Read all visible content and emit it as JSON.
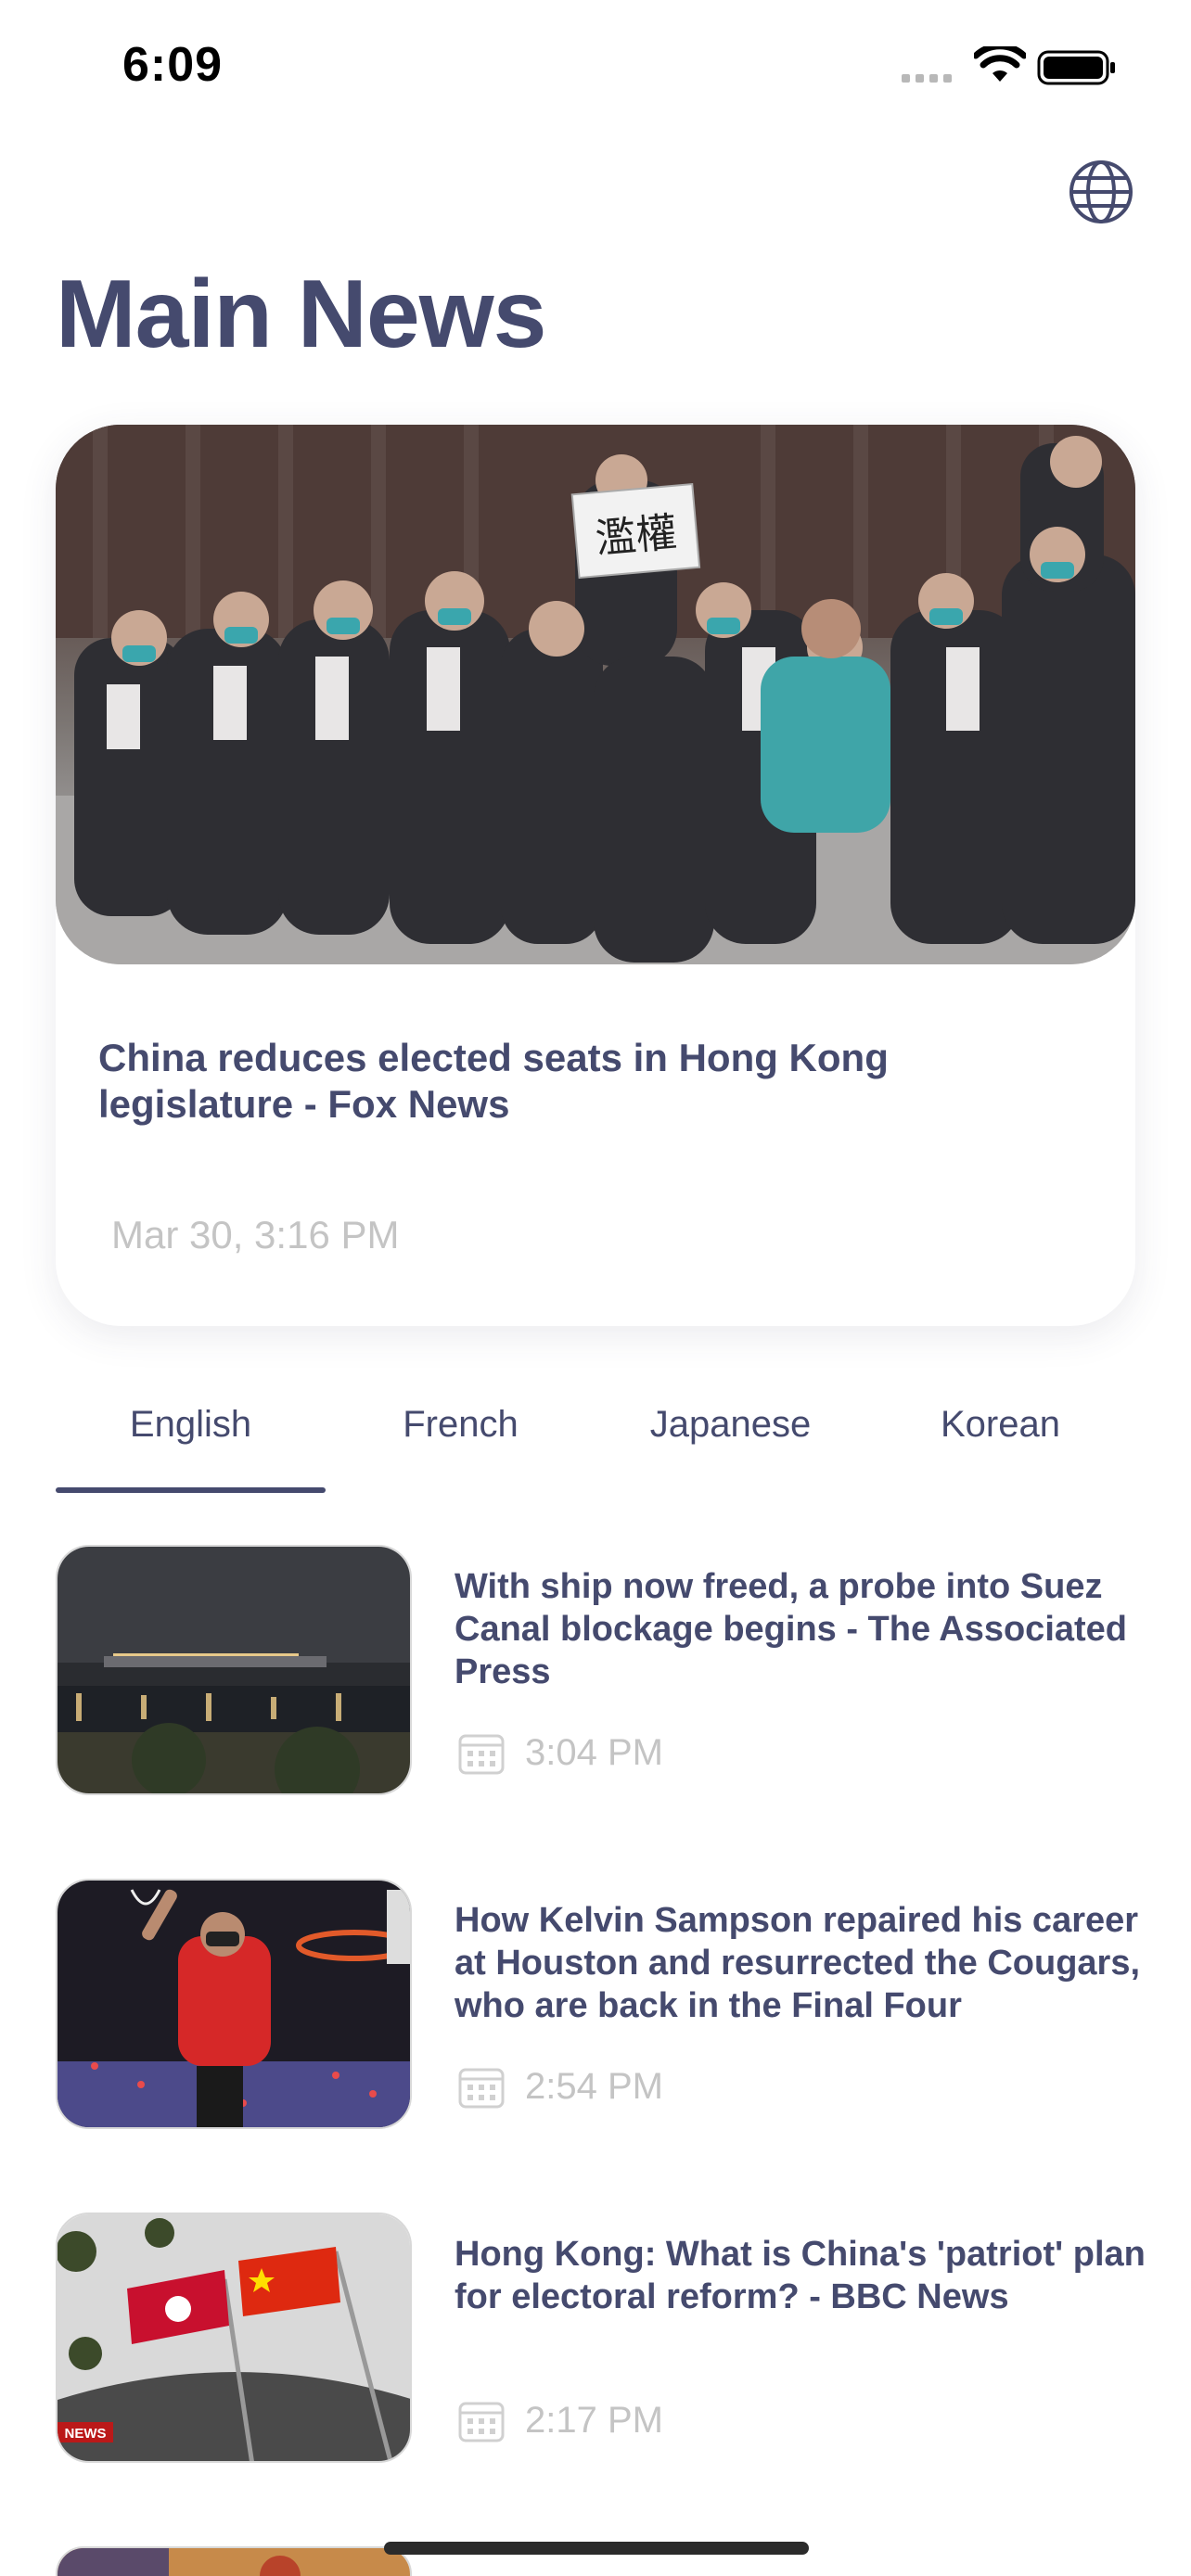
{
  "status_bar": {
    "time": "6:09"
  },
  "header": {
    "title": "Main News",
    "globe_icon": "globe-icon"
  },
  "featured": {
    "title": "China reduces elected seats in Hong Kong legislature - Fox News",
    "date": "Mar 30, 3:16 PM",
    "sign_text": "濫權"
  },
  "tabs": [
    {
      "label": "English",
      "active": true
    },
    {
      "label": "French",
      "active": false
    },
    {
      "label": "Japanese",
      "active": false
    },
    {
      "label": "Korean",
      "active": false
    }
  ],
  "news": [
    {
      "title": "With ship now freed, a probe into Suez Canal blockage begins - The Associated Press",
      "time": "3:04 PM"
    },
    {
      "title": "How Kelvin Sampson repaired his career at Houston and resurrected the Cougars, who are back in the Final Four",
      "time": "2:54 PM"
    },
    {
      "title": "Hong Kong: What is China's 'patriot' plan for electoral reform? - BBC News",
      "time": "2:17 PM",
      "badge": "NEWS"
    }
  ],
  "colors": {
    "primary": "#454a6e",
    "muted": "#c4c4c4",
    "background": "#ffffff"
  }
}
